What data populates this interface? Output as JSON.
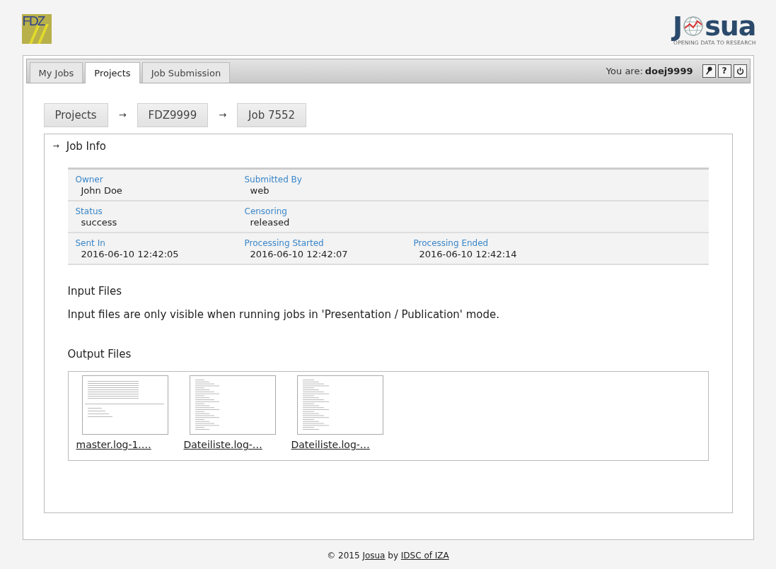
{
  "header": {
    "left_logo": "FDZ",
    "right_logo": {
      "first": "J",
      "rest": "sua",
      "tagline": "OPENING DATA TO RESEARCH"
    }
  },
  "tabs": [
    {
      "label": "My Jobs",
      "selected": false
    },
    {
      "label": "Projects",
      "selected": true
    },
    {
      "label": "Job Submission",
      "selected": false
    }
  ],
  "user": {
    "label": "You are:",
    "name": "doej9999"
  },
  "toolbar_buttons": [
    {
      "kind": "key"
    },
    {
      "kind": "help",
      "text": "?"
    },
    {
      "kind": "power"
    }
  ],
  "breadcrumb": {
    "items": [
      "Projects",
      "FDZ9999",
      "Job 7552"
    ],
    "separator": "→"
  },
  "job_info": {
    "toggle": "→",
    "title": "Job Info",
    "rows": [
      [
        {
          "label": "Owner",
          "value": "John Doe"
        },
        {
          "label": "Submitted By",
          "value": "web"
        }
      ],
      [
        {
          "label": "Status",
          "value": "success"
        },
        {
          "label": "Censoring",
          "value": "released"
        }
      ],
      [
        {
          "label": "Sent In",
          "value": "2016-06-10 12:42:05"
        },
        {
          "label": "Processing Started",
          "value": "2016-06-10 12:42:07"
        },
        {
          "label": "Processing Ended",
          "value": "2016-06-10 12:42:14"
        }
      ]
    ],
    "input_files": {
      "title": "Input Files",
      "message": "Input files are only visible when running jobs in 'Presentation / Publication' mode."
    },
    "output_files": {
      "title": "Output Files",
      "files": [
        {
          "name": "master.log-1.…",
          "kind": "summary"
        },
        {
          "name": "Dateiliste.log-…",
          "kind": "list"
        },
        {
          "name": "Dateiliste.log-…",
          "kind": "list"
        }
      ]
    }
  },
  "footer": {
    "copyright": "© 2015",
    "product": "Josua",
    "by": "by",
    "org": "IDSC of IZA"
  }
}
